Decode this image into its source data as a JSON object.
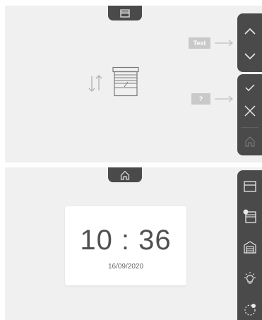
{
  "top_panel": {
    "test_label": "Test",
    "help_label": "?"
  },
  "bottom_panel": {
    "clock": {
      "time": "10 : 36",
      "date": "16/09/2020"
    }
  },
  "colors": {
    "panel_bg": "#f0f0f0",
    "dark_bar": "#4a4a4a",
    "label_box": "#c9c9c9",
    "icon_light": "#e8e8e8",
    "disabled_icon": "#7a7a7a"
  },
  "icons": {
    "top_tab_1": "blind-icon",
    "top_tab_2": "home-icon",
    "up": "chevron-up-icon",
    "down": "chevron-down-icon",
    "confirm": "check-icon",
    "cancel": "close-icon",
    "home": "home-icon",
    "side_menu": [
      "blind-icon",
      "blind-selected-icon",
      "garage-icon",
      "light-bulb-icon",
      "timer-icon"
    ]
  }
}
